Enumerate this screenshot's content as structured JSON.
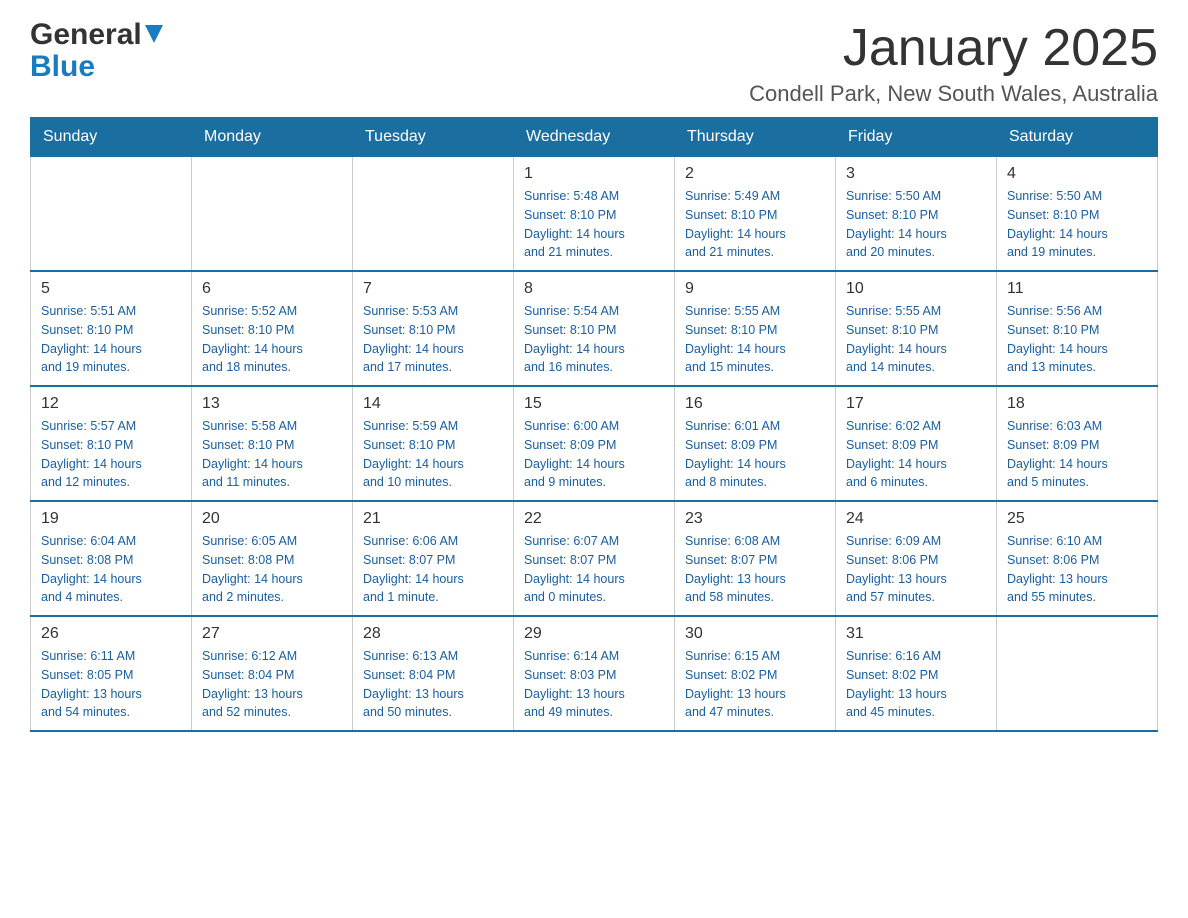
{
  "header": {
    "logo_general": "General",
    "logo_blue": "Blue",
    "main_title": "January 2025",
    "subtitle": "Condell Park, New South Wales, Australia"
  },
  "days_of_week": [
    "Sunday",
    "Monday",
    "Tuesday",
    "Wednesday",
    "Thursday",
    "Friday",
    "Saturday"
  ],
  "weeks": [
    [
      {
        "day": "",
        "info": ""
      },
      {
        "day": "",
        "info": ""
      },
      {
        "day": "",
        "info": ""
      },
      {
        "day": "1",
        "info": "Sunrise: 5:48 AM\nSunset: 8:10 PM\nDaylight: 14 hours\nand 21 minutes."
      },
      {
        "day": "2",
        "info": "Sunrise: 5:49 AM\nSunset: 8:10 PM\nDaylight: 14 hours\nand 21 minutes."
      },
      {
        "day": "3",
        "info": "Sunrise: 5:50 AM\nSunset: 8:10 PM\nDaylight: 14 hours\nand 20 minutes."
      },
      {
        "day": "4",
        "info": "Sunrise: 5:50 AM\nSunset: 8:10 PM\nDaylight: 14 hours\nand 19 minutes."
      }
    ],
    [
      {
        "day": "5",
        "info": "Sunrise: 5:51 AM\nSunset: 8:10 PM\nDaylight: 14 hours\nand 19 minutes."
      },
      {
        "day": "6",
        "info": "Sunrise: 5:52 AM\nSunset: 8:10 PM\nDaylight: 14 hours\nand 18 minutes."
      },
      {
        "day": "7",
        "info": "Sunrise: 5:53 AM\nSunset: 8:10 PM\nDaylight: 14 hours\nand 17 minutes."
      },
      {
        "day": "8",
        "info": "Sunrise: 5:54 AM\nSunset: 8:10 PM\nDaylight: 14 hours\nand 16 minutes."
      },
      {
        "day": "9",
        "info": "Sunrise: 5:55 AM\nSunset: 8:10 PM\nDaylight: 14 hours\nand 15 minutes."
      },
      {
        "day": "10",
        "info": "Sunrise: 5:55 AM\nSunset: 8:10 PM\nDaylight: 14 hours\nand 14 minutes."
      },
      {
        "day": "11",
        "info": "Sunrise: 5:56 AM\nSunset: 8:10 PM\nDaylight: 14 hours\nand 13 minutes."
      }
    ],
    [
      {
        "day": "12",
        "info": "Sunrise: 5:57 AM\nSunset: 8:10 PM\nDaylight: 14 hours\nand 12 minutes."
      },
      {
        "day": "13",
        "info": "Sunrise: 5:58 AM\nSunset: 8:10 PM\nDaylight: 14 hours\nand 11 minutes."
      },
      {
        "day": "14",
        "info": "Sunrise: 5:59 AM\nSunset: 8:10 PM\nDaylight: 14 hours\nand 10 minutes."
      },
      {
        "day": "15",
        "info": "Sunrise: 6:00 AM\nSunset: 8:09 PM\nDaylight: 14 hours\nand 9 minutes."
      },
      {
        "day": "16",
        "info": "Sunrise: 6:01 AM\nSunset: 8:09 PM\nDaylight: 14 hours\nand 8 minutes."
      },
      {
        "day": "17",
        "info": "Sunrise: 6:02 AM\nSunset: 8:09 PM\nDaylight: 14 hours\nand 6 minutes."
      },
      {
        "day": "18",
        "info": "Sunrise: 6:03 AM\nSunset: 8:09 PM\nDaylight: 14 hours\nand 5 minutes."
      }
    ],
    [
      {
        "day": "19",
        "info": "Sunrise: 6:04 AM\nSunset: 8:08 PM\nDaylight: 14 hours\nand 4 minutes."
      },
      {
        "day": "20",
        "info": "Sunrise: 6:05 AM\nSunset: 8:08 PM\nDaylight: 14 hours\nand 2 minutes."
      },
      {
        "day": "21",
        "info": "Sunrise: 6:06 AM\nSunset: 8:07 PM\nDaylight: 14 hours\nand 1 minute."
      },
      {
        "day": "22",
        "info": "Sunrise: 6:07 AM\nSunset: 8:07 PM\nDaylight: 14 hours\nand 0 minutes."
      },
      {
        "day": "23",
        "info": "Sunrise: 6:08 AM\nSunset: 8:07 PM\nDaylight: 13 hours\nand 58 minutes."
      },
      {
        "day": "24",
        "info": "Sunrise: 6:09 AM\nSunset: 8:06 PM\nDaylight: 13 hours\nand 57 minutes."
      },
      {
        "day": "25",
        "info": "Sunrise: 6:10 AM\nSunset: 8:06 PM\nDaylight: 13 hours\nand 55 minutes."
      }
    ],
    [
      {
        "day": "26",
        "info": "Sunrise: 6:11 AM\nSunset: 8:05 PM\nDaylight: 13 hours\nand 54 minutes."
      },
      {
        "day": "27",
        "info": "Sunrise: 6:12 AM\nSunset: 8:04 PM\nDaylight: 13 hours\nand 52 minutes."
      },
      {
        "day": "28",
        "info": "Sunrise: 6:13 AM\nSunset: 8:04 PM\nDaylight: 13 hours\nand 50 minutes."
      },
      {
        "day": "29",
        "info": "Sunrise: 6:14 AM\nSunset: 8:03 PM\nDaylight: 13 hours\nand 49 minutes."
      },
      {
        "day": "30",
        "info": "Sunrise: 6:15 AM\nSunset: 8:02 PM\nDaylight: 13 hours\nand 47 minutes."
      },
      {
        "day": "31",
        "info": "Sunrise: 6:16 AM\nSunset: 8:02 PM\nDaylight: 13 hours\nand 45 minutes."
      },
      {
        "day": "",
        "info": ""
      }
    ]
  ]
}
